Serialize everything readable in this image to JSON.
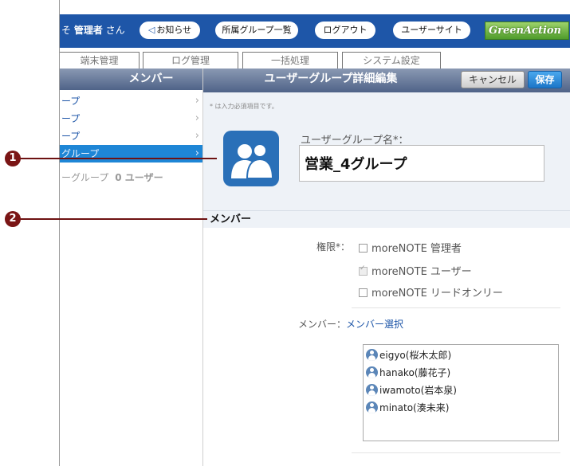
{
  "header": {
    "welcome_prefix": "そ ",
    "user_name": "管理者",
    "welcome_suffix": " さん",
    "buttons": {
      "notice": "お知らせ",
      "groups": "所属グループ一覧",
      "logout": "ログアウト",
      "user_site": "ユーザーサイト"
    },
    "logo_text": "GreenAction",
    "brand_color": "#1e56a8"
  },
  "tabs": [
    "端末管理",
    "ログ管理",
    "一括処理",
    "システム設定"
  ],
  "left_panel": {
    "title": "メンバー",
    "items": [
      {
        "label": "ープ",
        "selected": false
      },
      {
        "label": "ープ",
        "selected": false
      },
      {
        "label": "ープ",
        "selected": false
      },
      {
        "label": "グループ",
        "selected": true
      }
    ],
    "summary_name": "ーグループ",
    "summary_count": "0 ユーザー"
  },
  "editor": {
    "title": "ユーザーグループ詳細編集",
    "cancel_label": "キャンセル",
    "save_label": "保存",
    "required_note": "* は入力必須項目です。",
    "name_label": "ユーザーグループ名*：",
    "name_value": "営業_4グループ",
    "members_section": "メンバー",
    "permission_label": "権限*：",
    "permissions": [
      {
        "label": "moreNOTE 管理者",
        "checked": false
      },
      {
        "label": "moreNOTE ユーザー",
        "checked": true
      },
      {
        "label": "moreNOTE リードオンリー",
        "checked": false
      }
    ],
    "member_label": "メンバー：",
    "member_select_link": "メンバー選択",
    "members": [
      "eigyo(桜木太郎)",
      "hanako(藤花子)",
      "iwamoto(岩本泉)",
      "minato(湊未来)"
    ]
  },
  "callouts": [
    "1",
    "2"
  ]
}
